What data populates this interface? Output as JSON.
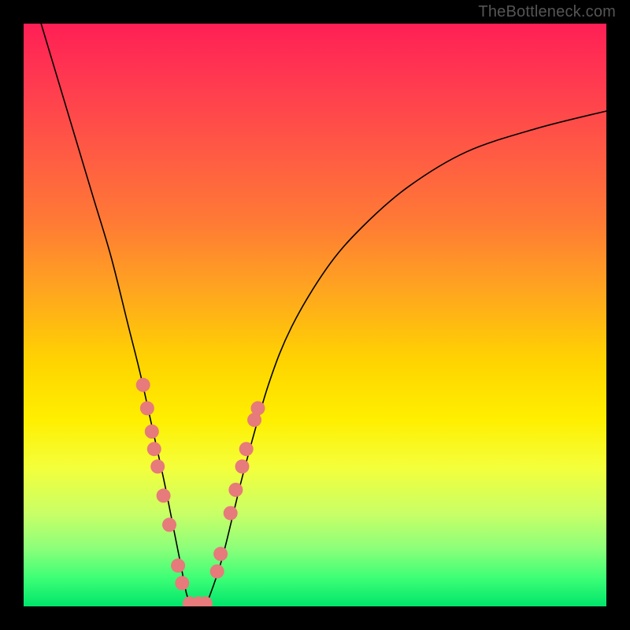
{
  "watermark": "TheBottleneck.com",
  "colors": {
    "frame": "#000000",
    "dot": "#e77a7a",
    "curve": "#000000"
  },
  "chart_data": {
    "type": "line",
    "title": "",
    "xlabel": "",
    "ylabel": "",
    "xlim": [
      0,
      100
    ],
    "ylim": [
      0,
      100
    ],
    "series": [
      {
        "name": "bottleneck-curve",
        "x": [
          3,
          6,
          9,
          12,
          15,
          18,
          20,
          22,
          24,
          26,
          27,
          28,
          29,
          30,
          31,
          32,
          34,
          36,
          38,
          42,
          46,
          52,
          58,
          66,
          76,
          88,
          100
        ],
        "y": [
          100,
          90,
          80,
          70,
          60,
          48,
          40,
          31,
          22,
          12,
          7,
          2,
          0,
          0,
          0,
          2,
          8,
          16,
          24,
          38,
          48,
          58,
          65,
          72,
          78,
          82,
          85
        ]
      }
    ],
    "markers": [
      {
        "x": 20.5,
        "y": 38
      },
      {
        "x": 21.2,
        "y": 34
      },
      {
        "x": 22.0,
        "y": 30
      },
      {
        "x": 22.4,
        "y": 27
      },
      {
        "x": 23.0,
        "y": 24
      },
      {
        "x": 24.0,
        "y": 19
      },
      {
        "x": 25.0,
        "y": 14
      },
      {
        "x": 26.5,
        "y": 7
      },
      {
        "x": 27.2,
        "y": 4
      },
      {
        "x": 28.5,
        "y": 0.5
      },
      {
        "x": 30.0,
        "y": 0.5
      },
      {
        "x": 31.2,
        "y": 0.5
      },
      {
        "x": 33.2,
        "y": 6
      },
      {
        "x": 33.8,
        "y": 9
      },
      {
        "x": 35.5,
        "y": 16
      },
      {
        "x": 36.4,
        "y": 20
      },
      {
        "x": 37.5,
        "y": 24
      },
      {
        "x": 38.2,
        "y": 27
      },
      {
        "x": 39.6,
        "y": 32
      },
      {
        "x": 40.2,
        "y": 34
      }
    ]
  }
}
